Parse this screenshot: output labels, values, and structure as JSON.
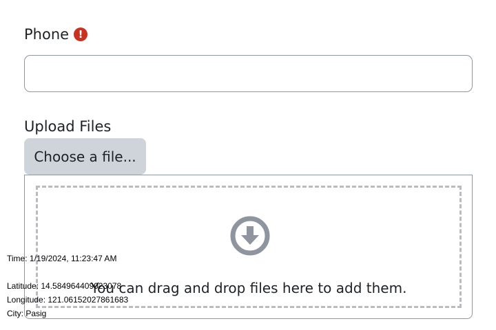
{
  "form": {
    "phone": {
      "label": "Phone",
      "required_icon": "exclamation-circle-icon",
      "required_symbol": "!",
      "value": "",
      "placeholder": ""
    },
    "upload": {
      "label": "Upload Files",
      "choose_button_label": "Choose a file...",
      "drop_icon": "download-circle-icon",
      "drop_text": "You can drag and drop files here to add them."
    }
  },
  "overlay": {
    "time": "Time: 1/19/2024, 11:23:47 AM",
    "latitude": "Latitude: 14.584964409023078",
    "longitude": "Longitude: 121.06152027861683",
    "city": "City: Pasig"
  },
  "colors": {
    "required": "#ca3120",
    "button_bg": "#ced4da",
    "border": "#8f959e",
    "dashed": "#b8bcc1",
    "icon": "#8f959e"
  }
}
